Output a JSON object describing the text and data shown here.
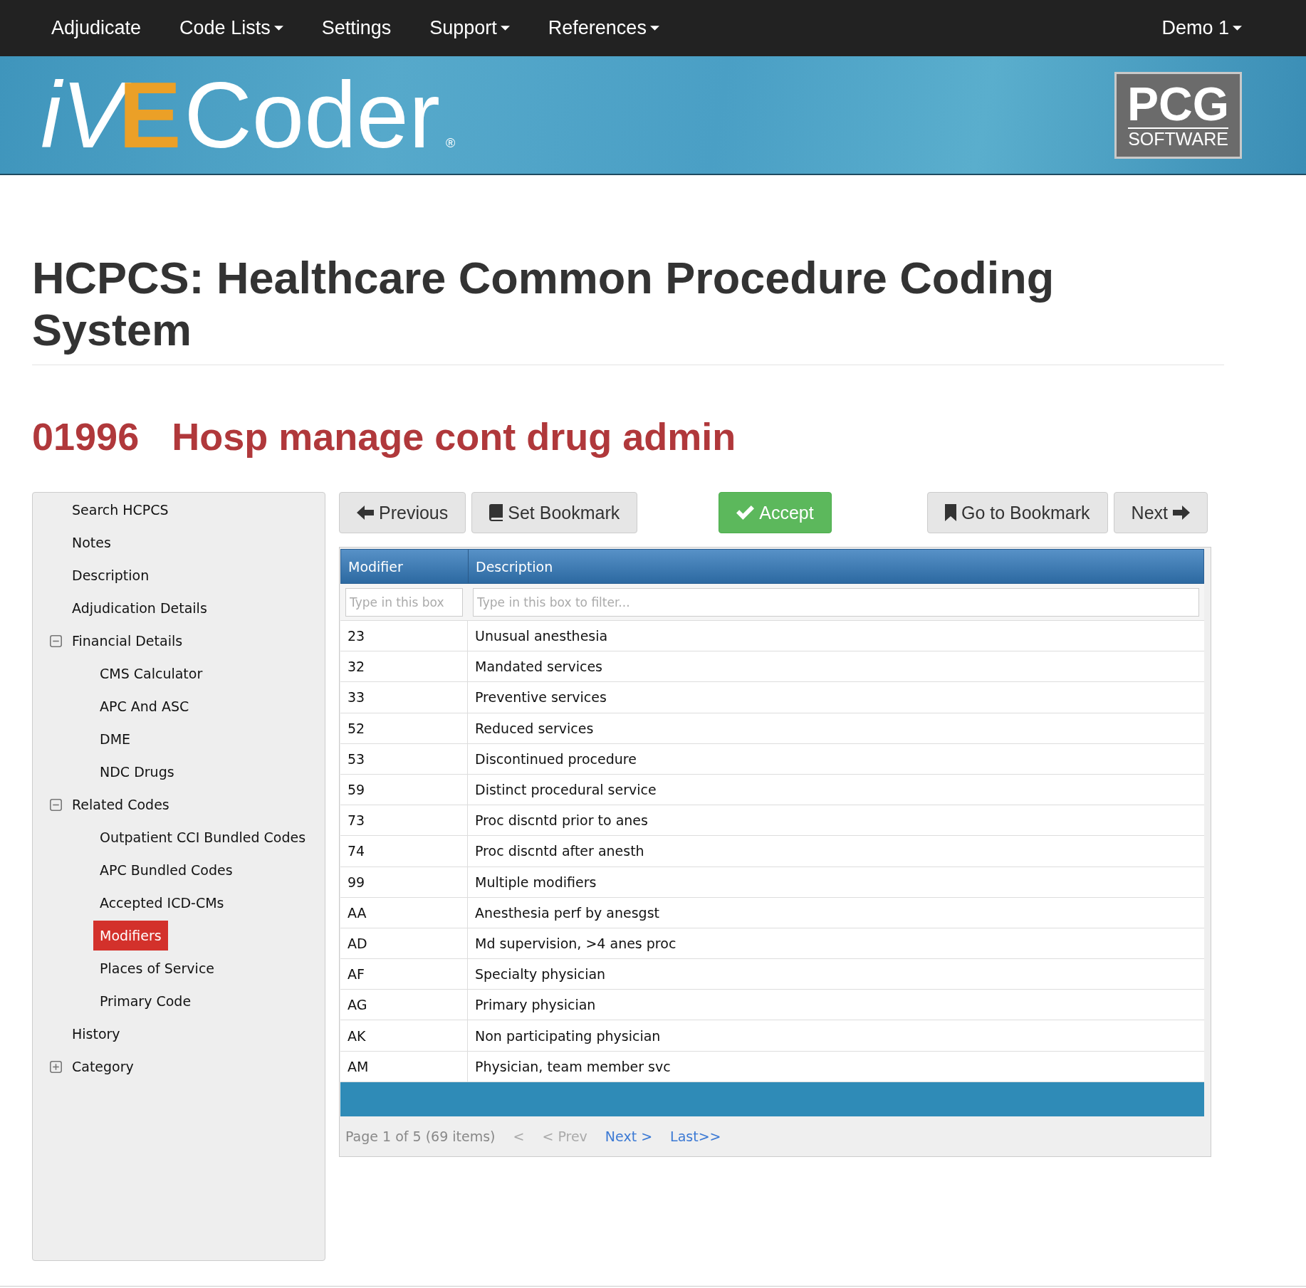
{
  "navbar": {
    "items": [
      {
        "label": "Adjudicate",
        "dropdown": false
      },
      {
        "label": "Code Lists",
        "dropdown": true
      },
      {
        "label": "Settings",
        "dropdown": false
      },
      {
        "label": "Support",
        "dropdown": true
      },
      {
        "label": "References",
        "dropdown": true
      }
    ],
    "user_menu": {
      "label": "Demo 1",
      "dropdown": true
    }
  },
  "banner": {
    "logo": {
      "prefix": "iV",
      "accent": "E",
      "word": "Coder",
      "registered": "®"
    },
    "badge": {
      "title": "PCG",
      "subtitle": "SOFTWARE"
    }
  },
  "page_title": "HCPCS: Healthcare Common Procedure Coding System",
  "code": {
    "number": "01996",
    "name": "Hosp manage cont drug admin"
  },
  "sidebar": {
    "items": [
      {
        "label": "Search HCPCS",
        "kind": "link",
        "selected": false
      },
      {
        "label": "Notes",
        "kind": "link",
        "selected": false
      },
      {
        "label": "Description",
        "kind": "link",
        "selected": false
      },
      {
        "label": "Adjudication Details",
        "kind": "link",
        "selected": false
      },
      {
        "label": "Financial Details",
        "kind": "group",
        "expanded": true,
        "selected": false,
        "children": [
          {
            "label": "CMS Calculator",
            "kind": "link",
            "selected": false
          },
          {
            "label": "APC And ASC",
            "kind": "link",
            "selected": false
          },
          {
            "label": "DME",
            "kind": "link",
            "selected": false
          },
          {
            "label": "NDC Drugs",
            "kind": "link",
            "selected": false
          }
        ]
      },
      {
        "label": "Related Codes",
        "kind": "group",
        "expanded": true,
        "selected": false,
        "children": [
          {
            "label": "Outpatient CCI Bundled Codes",
            "kind": "link",
            "selected": false
          },
          {
            "label": "APC Bundled Codes",
            "kind": "link",
            "selected": false
          },
          {
            "label": "Accepted ICD-CMs",
            "kind": "link",
            "selected": false
          },
          {
            "label": "Modifiers",
            "kind": "link",
            "selected": true
          },
          {
            "label": "Places of Service",
            "kind": "link",
            "selected": false
          },
          {
            "label": "Primary Code",
            "kind": "link",
            "selected": false
          }
        ]
      },
      {
        "label": "History",
        "kind": "link",
        "selected": false
      },
      {
        "label": "Category",
        "kind": "group",
        "expanded": false,
        "selected": false
      }
    ]
  },
  "toolbar": {
    "start": [
      {
        "label": "Previous",
        "kind": "back"
      },
      {
        "label": "Set Bookmark",
        "kind": "set-bookmark"
      }
    ],
    "middle": [
      {
        "label": "Accept",
        "kind": "accept"
      }
    ],
    "end": [
      {
        "label": "Go to Bookmark",
        "kind": "go-to-bookmark"
      },
      {
        "label": "Next",
        "kind": "forward"
      }
    ]
  },
  "table": {
    "columns": [
      {
        "label": "Modifier",
        "filter": {
          "placeholder": "Type in this box"
        }
      },
      {
        "label": "Description",
        "filter": {
          "placeholder": "Type in this box to filter..."
        }
      }
    ],
    "rows": [
      {
        "modifier": "23",
        "description": "Unusual anesthesia"
      },
      {
        "modifier": "32",
        "description": "Mandated services"
      },
      {
        "modifier": "33",
        "description": "Preventive services"
      },
      {
        "modifier": "52",
        "description": "Reduced services"
      },
      {
        "modifier": "53",
        "description": "Discontinued procedure"
      },
      {
        "modifier": "59",
        "description": "Distinct procedural service"
      },
      {
        "modifier": "73",
        "description": "Proc discntd prior to anes"
      },
      {
        "modifier": "74",
        "description": "Proc discntd after anesth"
      },
      {
        "modifier": "99",
        "description": "Multiple modifiers"
      },
      {
        "modifier": "AA",
        "description": "Anesthesia perf by anesgst"
      },
      {
        "modifier": "AD",
        "description": "Md supervision, >4 anes proc"
      },
      {
        "modifier": "AF",
        "description": "Specialty physician"
      },
      {
        "modifier": "AG",
        "description": "Primary physician"
      },
      {
        "modifier": "AK",
        "description": "Non participating physician"
      },
      {
        "modifier": "AM",
        "description": "Physician, team member svc"
      }
    ]
  },
  "pager": {
    "summary": "Page 1 of 5 (69 items)",
    "links": [
      {
        "label": "<",
        "disabled": true
      },
      {
        "label": "< Prev",
        "disabled": true
      },
      {
        "label": "Next >",
        "disabled": false
      },
      {
        "label": "Last>>",
        "disabled": false
      }
    ]
  }
}
